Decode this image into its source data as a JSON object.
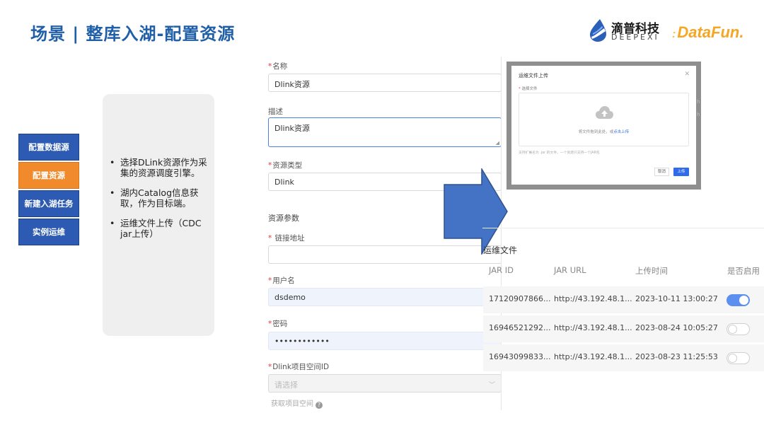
{
  "slide": {
    "title": "场景 | 整库入湖-配置资源"
  },
  "logos": {
    "deepexi_cn": "滴普科技",
    "deepexi_en": "DEEPEXI",
    "datafun": "DataFun.",
    "datafun_mark": ":"
  },
  "steps": [
    {
      "label": "配置数据源",
      "active": false
    },
    {
      "label": "配置资源",
      "active": true
    },
    {
      "label": "新建入湖任务",
      "active": false
    },
    {
      "label": "实例运维",
      "active": false
    }
  ],
  "notes": [
    "选择DLink资源作为采集的资源调度引擎。",
    "湖内Catalog信息获取，作为目标端。",
    "运维文件上传（CDC jar上传）"
  ],
  "bullet_glyph": "•",
  "form": {
    "required_mark": "*",
    "name_label": "名称",
    "name_value": "Dlink资源",
    "desc_label": "描述",
    "desc_value": "Dlink资源",
    "type_label": "资源类型",
    "type_value": "Dlink",
    "params_title": "资源参数",
    "url_label": "链接地址",
    "url_value": "",
    "user_label": "用户名",
    "user_value": "dsdemo",
    "pwd_label": "密码",
    "pwd_value": "••••••••••••",
    "space_label": "Dlink项目空间ID",
    "space_placeholder": "请选择",
    "space_help": "获取项目空间"
  },
  "dialog": {
    "title": "运维文件上传",
    "field_label": "选择文件",
    "drop_text": "将文件拖到此处，或",
    "drop_link": "点击上传",
    "hint": "支持扩展名为 .jar 的文件，一个资源只支持一个JAR包",
    "cancel": "取消",
    "ok": "上传",
    "bg_text_1": "h",
    "bg_text_2": "h"
  },
  "ops_table": {
    "title": "运维文件",
    "columns": [
      "JAR ID",
      "JAR URL",
      "上传时间",
      "是否启用"
    ],
    "rows": [
      {
        "id": "17120907866...",
        "url": "http://43.192.48.1...",
        "time": "2023-10-11 13:00:27",
        "enabled": true
      },
      {
        "id": "16946521292...",
        "url": "http://43.192.48.1...",
        "time": "2023-08-24 10:05:27",
        "enabled": false
      },
      {
        "id": "16943099833...",
        "url": "http://43.192.48.1...",
        "time": "2023-08-23 11:25:53",
        "enabled": false
      }
    ]
  },
  "colors": {
    "title_blue": "#1f5fa8",
    "step_blue": "#2d5bb3",
    "step_orange": "#f08a2a",
    "arrow_blue": "#4472c4",
    "toggle_on": "#5b8ff0"
  },
  "icons": {
    "arrow": "right-arrow-icon",
    "cloud": "cloud-upload-icon",
    "close": "close-icon",
    "help": "question-circle-icon",
    "select": "chevron-down-icon"
  }
}
